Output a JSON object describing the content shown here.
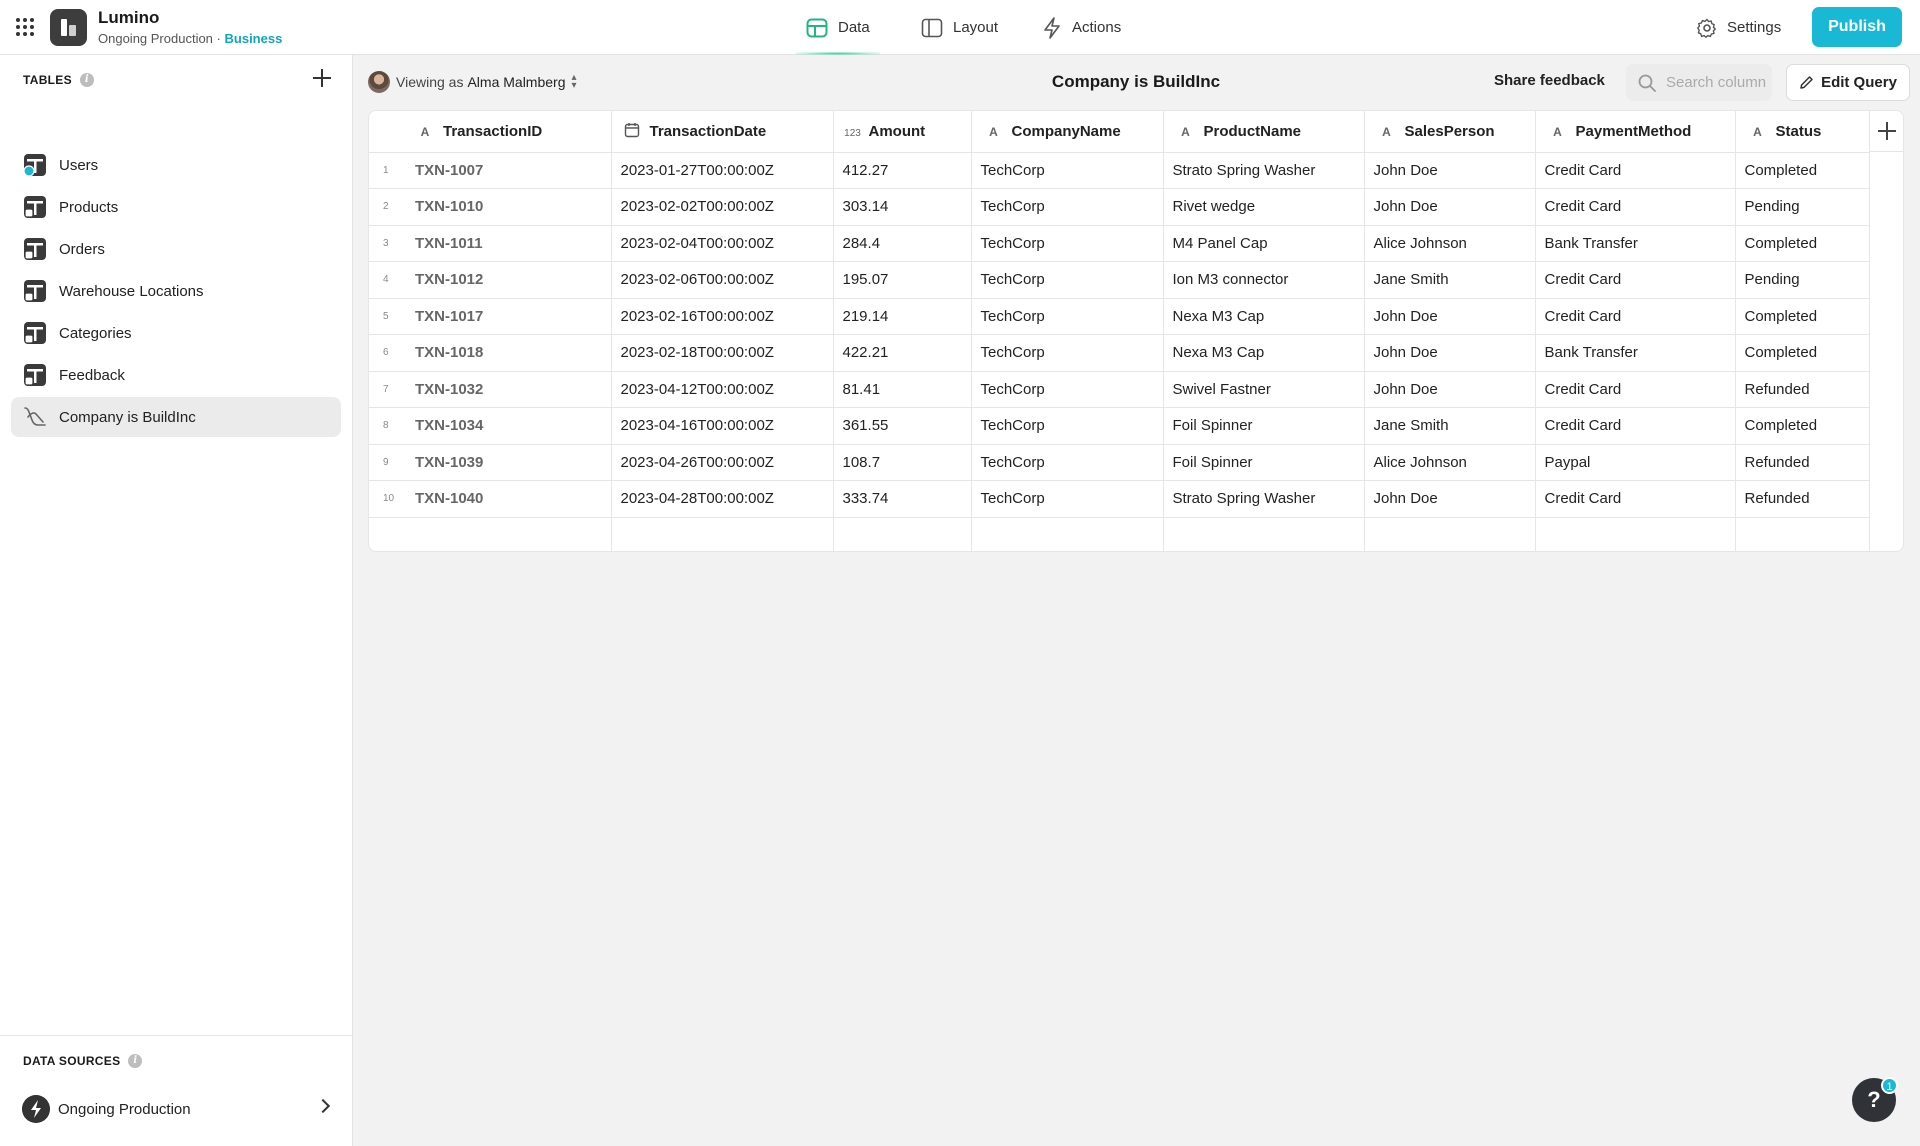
{
  "app": {
    "name": "Lumino",
    "subtitle": "Ongoing Production",
    "separator": "·",
    "environment": "Business"
  },
  "nav": {
    "tabs": [
      {
        "label": "Data",
        "icon": "table-icon",
        "active": true
      },
      {
        "label": "Layout",
        "icon": "layout-icon",
        "active": false
      },
      {
        "label": "Actions",
        "icon": "lightning-icon",
        "active": false
      }
    ],
    "settings_label": "Settings",
    "publish_label": "Publish"
  },
  "sidebar": {
    "tables_heading": "TABLES",
    "items": [
      {
        "label": "Users",
        "icon": "user-table-icon"
      },
      {
        "label": "Products",
        "icon": "table-icon"
      },
      {
        "label": "Orders",
        "icon": "table-icon"
      },
      {
        "label": "Warehouse Locations",
        "icon": "table-icon"
      },
      {
        "label": "Categories",
        "icon": "table-icon"
      },
      {
        "label": "Feedback",
        "icon": "table-icon"
      },
      {
        "label": "Company is BuildInc",
        "icon": "query-icon",
        "active": true
      }
    ],
    "data_sources_heading": "DATA SOURCES",
    "data_source": "Ongoing Production",
    "info_glyph": "i"
  },
  "toolbar": {
    "viewing_prefix": "Viewing as",
    "viewing_user": "Alma Malmberg",
    "title": "Company is BuildInc",
    "share_feedback": "Share feedback",
    "search_placeholder": "Search columns",
    "edit_query": "Edit Query"
  },
  "table": {
    "columns": [
      {
        "label": "TransactionID",
        "type_glyph": "A"
      },
      {
        "label": "TransactionDate",
        "type_glyph": "calendar"
      },
      {
        "label": "Amount",
        "type_glyph": "123"
      },
      {
        "label": "CompanyName",
        "type_glyph": "A"
      },
      {
        "label": "ProductName",
        "type_glyph": "A"
      },
      {
        "label": "SalesPerson",
        "type_glyph": "A"
      },
      {
        "label": "PaymentMethod",
        "type_glyph": "A"
      },
      {
        "label": "Status",
        "type_glyph": "A"
      }
    ],
    "rows": [
      [
        "1",
        "TXN-1007",
        "2023-01-27T00:00:00Z",
        "412.27",
        "TechCorp",
        "Strato Spring Washer",
        "John Doe",
        "Credit Card",
        "Completed"
      ],
      [
        "2",
        "TXN-1010",
        "2023-02-02T00:00:00Z",
        "303.14",
        "TechCorp",
        "Rivet wedge",
        "John Doe",
        "Credit Card",
        "Pending"
      ],
      [
        "3",
        "TXN-1011",
        "2023-02-04T00:00:00Z",
        "284.4",
        "TechCorp",
        "M4 Panel Cap",
        "Alice Johnson",
        "Bank Transfer",
        "Completed"
      ],
      [
        "4",
        "TXN-1012",
        "2023-02-06T00:00:00Z",
        "195.07",
        "TechCorp",
        "Ion M3 connector",
        "Jane Smith",
        "Credit Card",
        "Pending"
      ],
      [
        "5",
        "TXN-1017",
        "2023-02-16T00:00:00Z",
        "219.14",
        "TechCorp",
        "Nexa M3 Cap",
        "John Doe",
        "Credit Card",
        "Completed"
      ],
      [
        "6",
        "TXN-1018",
        "2023-02-18T00:00:00Z",
        "422.21",
        "TechCorp",
        "Nexa M3 Cap",
        "John Doe",
        "Bank Transfer",
        "Completed"
      ],
      [
        "7",
        "TXN-1032",
        "2023-04-12T00:00:00Z",
        "81.41",
        "TechCorp",
        "Swivel Fastner",
        "John Doe",
        "Credit Card",
        "Refunded"
      ],
      [
        "8",
        "TXN-1034",
        "2023-04-16T00:00:00Z",
        "361.55",
        "TechCorp",
        "Foil Spinner",
        "Jane Smith",
        "Credit Card",
        "Completed"
      ],
      [
        "9",
        "TXN-1039",
        "2023-04-26T00:00:00Z",
        "108.7",
        "TechCorp",
        "Foil Spinner",
        "Alice Johnson",
        "Paypal",
        "Refunded"
      ],
      [
        "10",
        "TXN-1040",
        "2023-04-28T00:00:00Z",
        "333.74",
        "TechCorp",
        "Strato Spring Washer",
        "John Doe",
        "Credit Card",
        "Refunded"
      ]
    ]
  },
  "help": {
    "glyph": "?",
    "badge_count": "1"
  },
  "colors": {
    "accent": "#19b8d4",
    "active_tab": "#29d197",
    "environment": "#0fa4c2"
  }
}
